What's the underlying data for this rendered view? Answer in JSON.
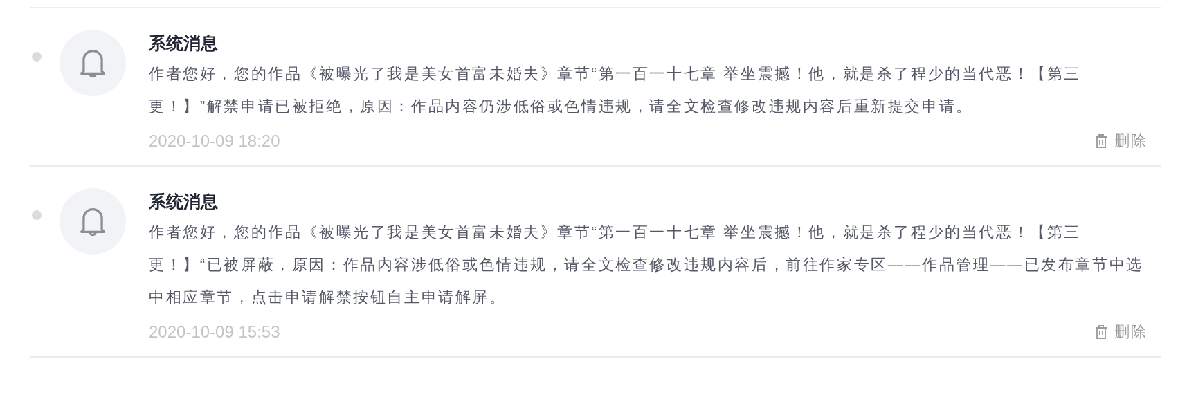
{
  "messages": [
    {
      "title": "系统消息",
      "body": "作者您好，您的作品《被曝光了我是美女首富未婚夫》章节“第一百一十七章 举坐震撼！他，就是杀了程少的当代恶！【第三更！】”解禁申请已被拒绝，原因：作品内容仍涉低俗或色情违规，请全文检查修改违规内容后重新提交申请。",
      "time": "2020-10-09 18:20",
      "delete_label": "删除",
      "unread": false
    },
    {
      "title": "系统消息",
      "body": "作者您好，您的作品《被曝光了我是美女首富未婚夫》章节“第一百一十七章 举坐震撼！他，就是杀了程少的当代恶！【第三更！】“已被屏蔽，原因：作品内容涉低俗或色情违规，请全文检查修改违规内容后，前往作家专区——作品管理——已发布章节中选中相应章节，点击申请解禁按钮自主申请解屏。",
      "time": "2020-10-09 15:53",
      "delete_label": "删除",
      "unread": false
    }
  ]
}
